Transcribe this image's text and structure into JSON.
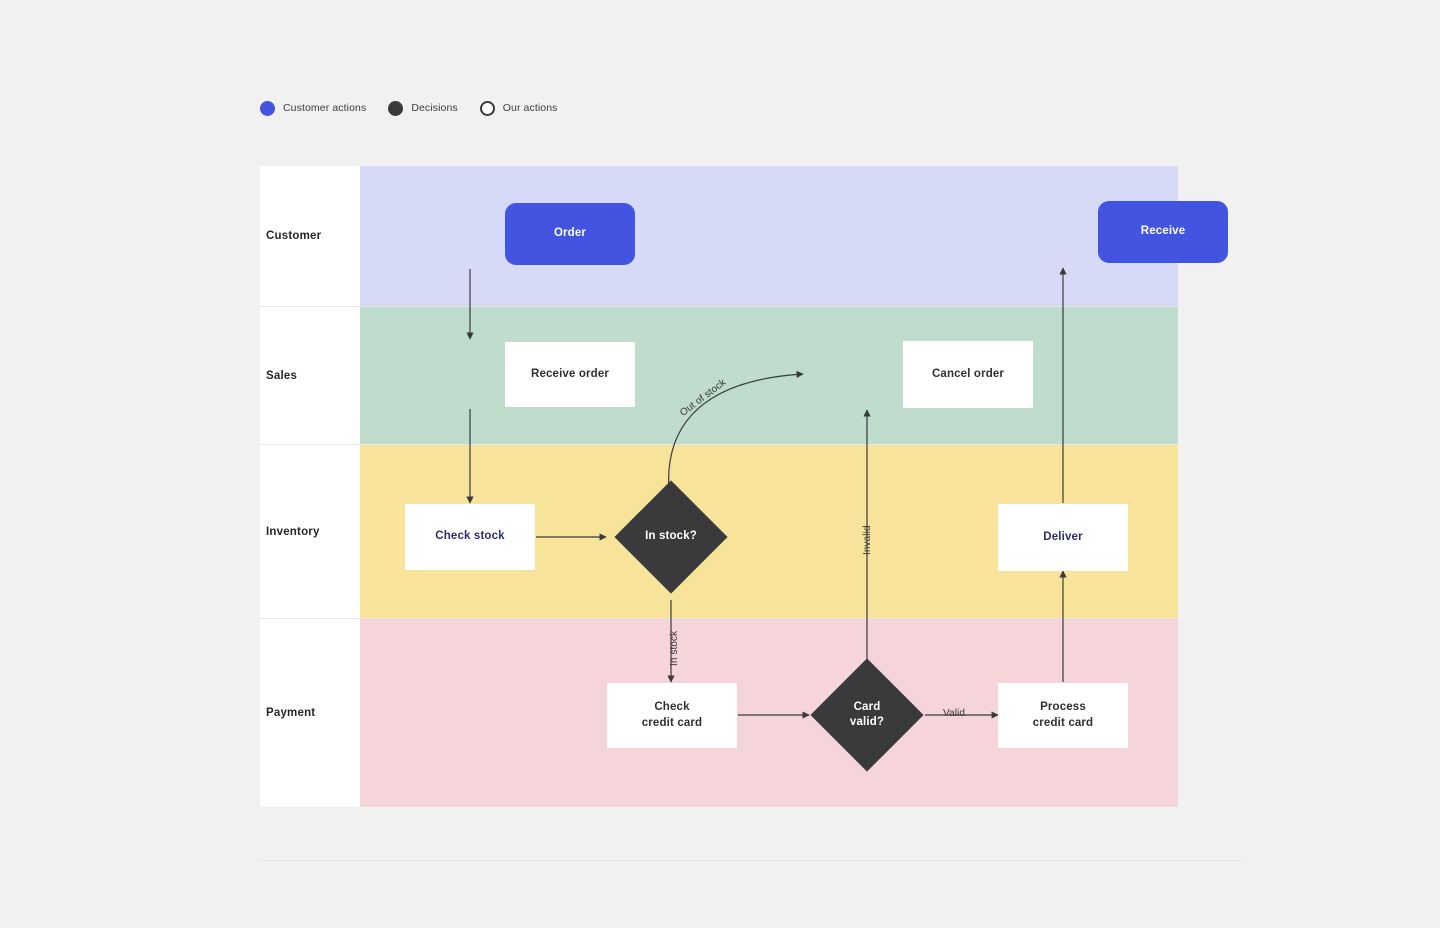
{
  "legend": {
    "items": [
      {
        "label": "Customer actions",
        "style": "filled-blue",
        "color": "#4354e0",
        "icon": "filled-circle-icon"
      },
      {
        "label": "Decisions",
        "style": "filled-dark",
        "color": "#3a3a3c",
        "icon": "filled-circle-icon"
      },
      {
        "label": "Our actions",
        "style": "outline",
        "color": "#ffffff",
        "icon": "outline-circle-icon"
      }
    ]
  },
  "lanes": [
    {
      "id": "customer",
      "label": "Customer",
      "color": "#d7daf7"
    },
    {
      "id": "sales",
      "label": "Sales",
      "color": "#bfdccd"
    },
    {
      "id": "inventory",
      "label": "Inventory",
      "color": "#f8e39a"
    },
    {
      "id": "payment",
      "label": "Payment",
      "color": "#f6d5da"
    }
  ],
  "nodes": [
    {
      "id": "order",
      "label": "Order",
      "lane": "customer",
      "type": "customer"
    },
    {
      "id": "receive",
      "label": "Receive",
      "lane": "customer",
      "type": "customer"
    },
    {
      "id": "receive-order",
      "label": "Receive order",
      "lane": "sales",
      "type": "process"
    },
    {
      "id": "cancel-order",
      "label": "Cancel order",
      "lane": "sales",
      "type": "process"
    },
    {
      "id": "check-stock",
      "label": "Check stock",
      "lane": "inventory",
      "type": "process"
    },
    {
      "id": "in-stock",
      "label": "In stock?",
      "lane": "inventory",
      "type": "decision"
    },
    {
      "id": "deliver",
      "label": "Deliver",
      "lane": "inventory",
      "type": "process"
    },
    {
      "id": "check-cc",
      "label": "Check\ncredit card",
      "lane": "payment",
      "type": "process"
    },
    {
      "id": "card-valid",
      "label": "Card\nvalid?",
      "lane": "payment",
      "type": "decision"
    },
    {
      "id": "process-cc",
      "label": "Process\ncredit card",
      "lane": "payment",
      "type": "process"
    }
  ],
  "edge_labels": {
    "out_of_stock": "Out of stock",
    "in_stock": "In stock",
    "invalid": "Invalid",
    "valid": "Valid"
  },
  "colors": {
    "background": "#f1f1f1",
    "customer_node": "#4354e0",
    "decision_node": "#3a3a3c",
    "process_node": "#ffffff",
    "edge": "#3a3a3c"
  }
}
